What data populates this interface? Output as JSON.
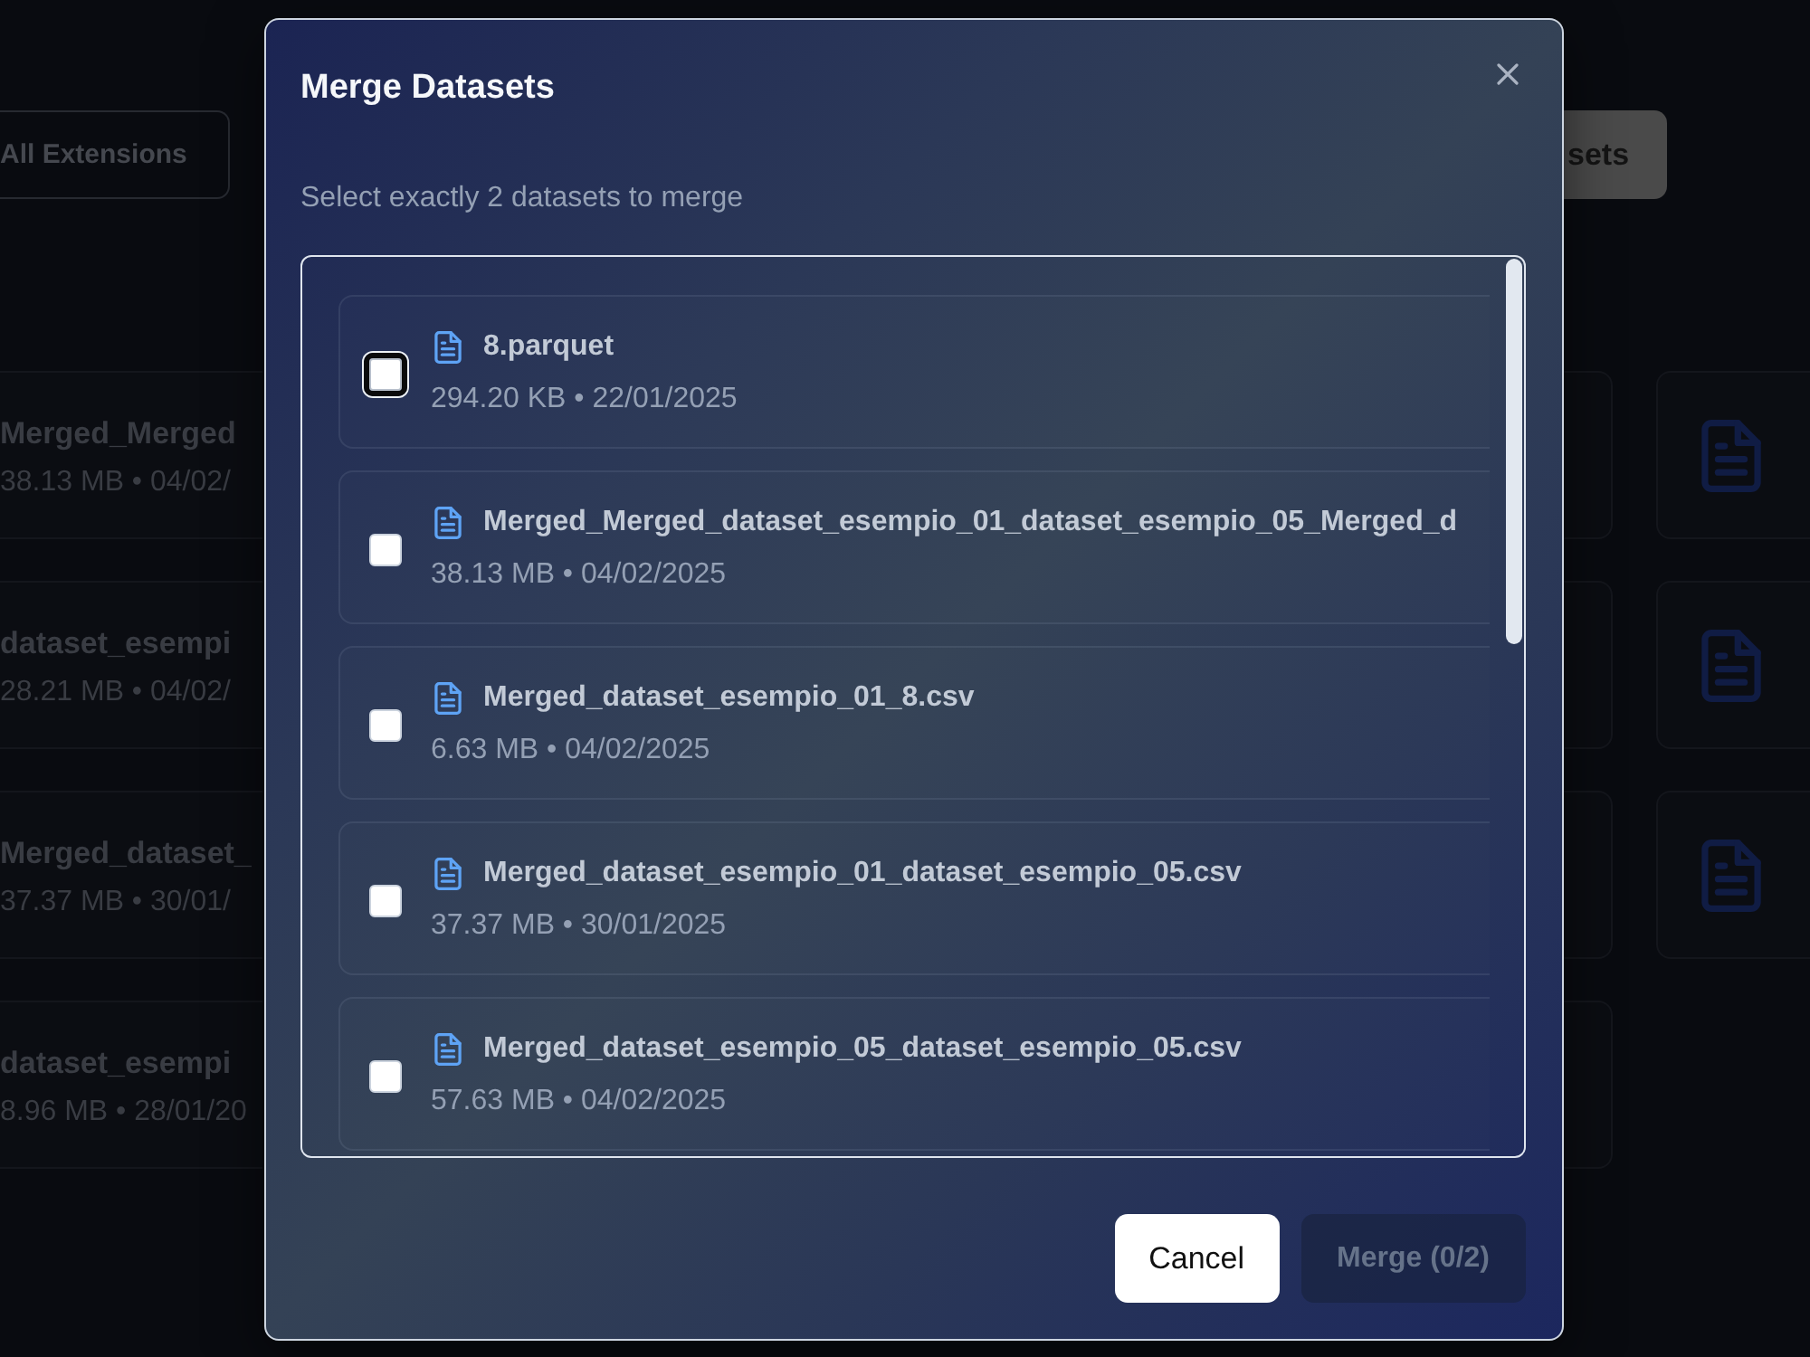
{
  "backdrop": {
    "toolbar": [
      {
        "label": "All Extensions",
        "kind": "outline"
      },
      {
        "label": "sets",
        "kind": "filled"
      }
    ],
    "dataset_cards": [
      {
        "name": "Merged_Merged",
        "meta": "38.13 MB • 04/02/"
      },
      {
        "name": "dataset_esempi",
        "meta": "28.21 MB • 04/02/"
      },
      {
        "name": "Merged_dataset_",
        "meta": "37.37 MB • 30/01/"
      },
      {
        "name": "dataset_esempi",
        "meta": "8.96 MB • 28/01/20"
      }
    ]
  },
  "dialog": {
    "title": "Merge Datasets",
    "instruction": "Select exactly 2 datasets to merge",
    "datasets": [
      {
        "name": "8.parquet",
        "meta": "294.20 KB • 22/01/2025",
        "checked": false,
        "focused": true
      },
      {
        "name": "Merged_Merged_dataset_esempio_01_dataset_esempio_05_Merged_d",
        "meta": "38.13 MB • 04/02/2025",
        "checked": false,
        "focused": false
      },
      {
        "name": "Merged_dataset_esempio_01_8.csv",
        "meta": "6.63 MB • 04/02/2025",
        "checked": false,
        "focused": false
      },
      {
        "name": "Merged_dataset_esempio_01_dataset_esempio_05.csv",
        "meta": "37.37 MB • 30/01/2025",
        "checked": false,
        "focused": false
      },
      {
        "name": "Merged_dataset_esempio_05_dataset_esempio_05.csv",
        "meta": "57.63 MB • 04/02/2025",
        "checked": false,
        "focused": false
      }
    ],
    "buttons": [
      {
        "label": "Cancel",
        "kind": "secondary",
        "disabled": false
      },
      {
        "label": "Merge (0/2)",
        "kind": "primary",
        "disabled": true
      }
    ]
  }
}
